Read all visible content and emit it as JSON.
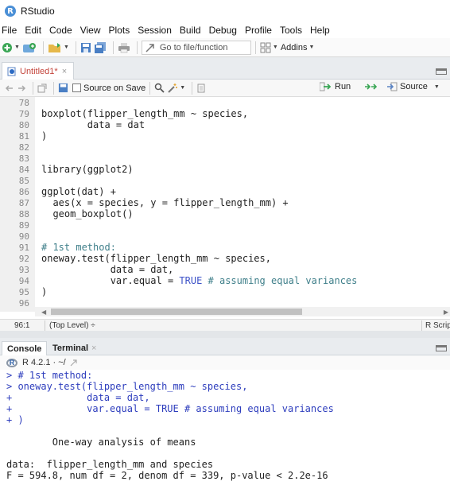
{
  "app": {
    "title": "RStudio",
    "icon_letter": "R"
  },
  "menu": [
    "File",
    "Edit",
    "Code",
    "View",
    "Plots",
    "Session",
    "Build",
    "Debug",
    "Profile",
    "Tools",
    "Help"
  ],
  "toolbar": {
    "goto_placeholder": "Go to file/function",
    "addins_label": "Addins"
  },
  "editor": {
    "tab_label": "Untitled1*",
    "tab_close": "×",
    "source_on_save_label": "Source on Save",
    "run_label": "Run",
    "source_label": "Source",
    "lines": [
      {
        "n": "78",
        "text": ""
      },
      {
        "n": "79",
        "text": "boxplot(flipper_length_mm ~ species,"
      },
      {
        "n": "80",
        "text": "        data = dat"
      },
      {
        "n": "81",
        "text": ")"
      },
      {
        "n": "82",
        "text": ""
      },
      {
        "n": "83",
        "text": ""
      },
      {
        "n": "84",
        "text": "library(ggplot2)"
      },
      {
        "n": "85",
        "text": ""
      },
      {
        "n": "86",
        "text": "ggplot(dat) +"
      },
      {
        "n": "87",
        "text": "  aes(x = species, y = flipper_length_mm) +"
      },
      {
        "n": "88",
        "text": "  geom_boxplot()"
      },
      {
        "n": "89",
        "text": ""
      },
      {
        "n": "90",
        "text": ""
      },
      {
        "n": "91",
        "text": "# 1st method:"
      },
      {
        "n": "92",
        "text": "oneway.test(flipper_length_mm ~ species,"
      },
      {
        "n": "93",
        "text": "            data = dat,"
      },
      {
        "n": "94",
        "text": "            var.equal = TRUE # assuming equal variances"
      },
      {
        "n": "95",
        "text": ")"
      },
      {
        "n": "96",
        "text": ""
      }
    ],
    "status_position": "96:1",
    "status_scope": "(Top Level) ÷",
    "status_filetype": "R Script"
  },
  "console": {
    "tab_console": "Console",
    "tab_terminal": "Terminal",
    "tab_close": "×",
    "r_version": "R 4.2.1 · ~/",
    "lines": [
      {
        "text": "> # 1st method:",
        "type": "input"
      },
      {
        "text": "> oneway.test(flipper_length_mm ~ species,",
        "type": "input"
      },
      {
        "text": "+             data = dat,",
        "type": "input"
      },
      {
        "text": "+             var.equal = TRUE # assuming equal variances",
        "type": "input"
      },
      {
        "text": "+ )",
        "type": "input"
      },
      {
        "text": "",
        "type": "output"
      },
      {
        "text": "        One-way analysis of means",
        "type": "output"
      },
      {
        "text": "",
        "type": "output"
      },
      {
        "text": "data:  flipper_length_mm and species",
        "type": "output"
      },
      {
        "text": "F = 594.8, num df = 2, denom df = 339, p-value < 2.2e-16",
        "type": "output"
      }
    ]
  }
}
